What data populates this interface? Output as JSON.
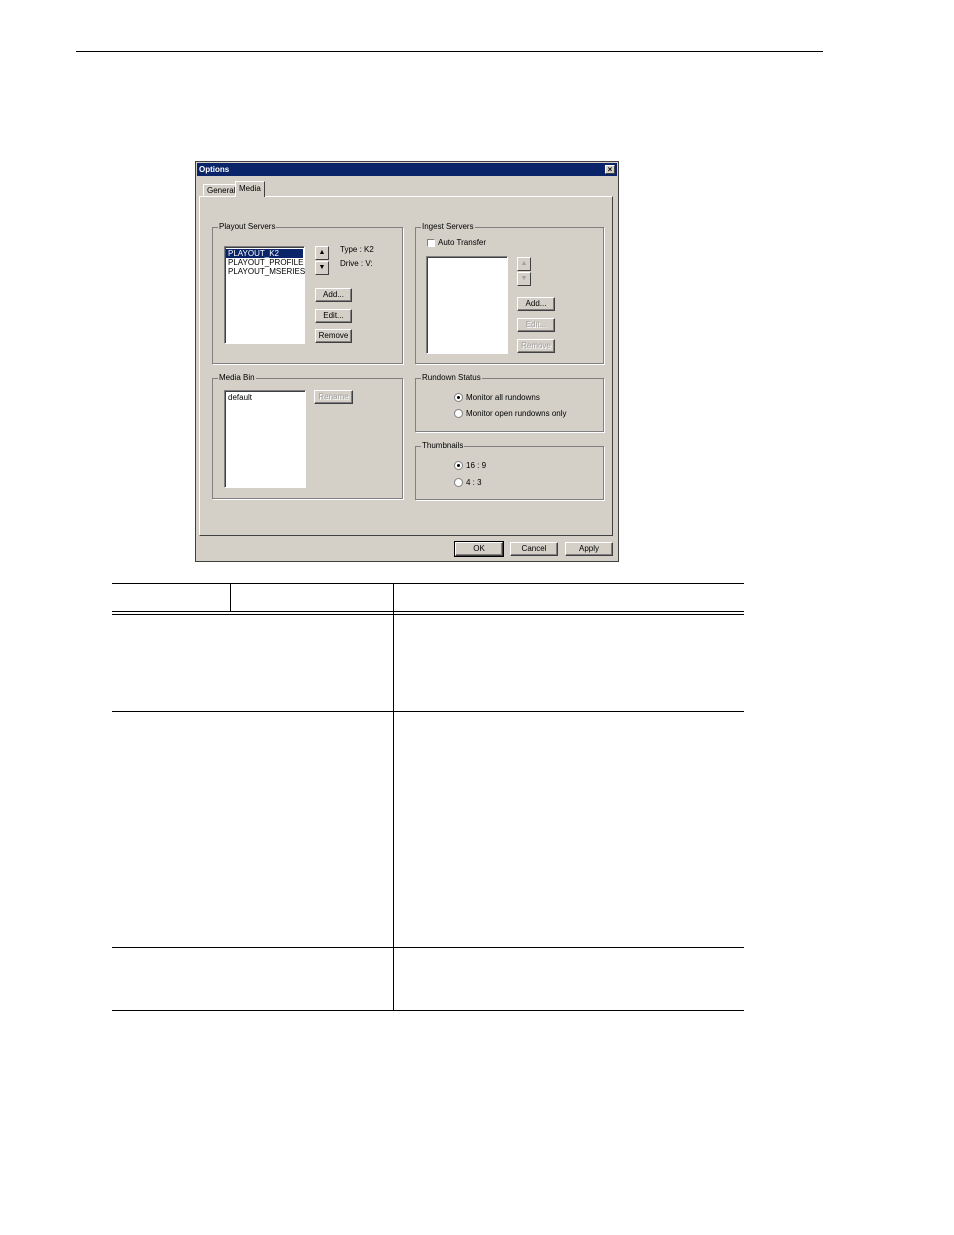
{
  "dialog": {
    "title": "Options",
    "close_glyph": "×",
    "tabs": [
      {
        "label": "General"
      },
      {
        "label": "Media"
      }
    ],
    "playout_servers": {
      "legend": "Playout Servers",
      "items": [
        "PLAYOUT_K2",
        "PLAYOUT_PROFILE",
        "PLAYOUT_MSERIES"
      ],
      "selected_index": 0,
      "type_text": "Type :  K2",
      "drive_text": "Drive :  V:",
      "add_label": "Add...",
      "edit_label": "Edit...",
      "remove_label": "Remove"
    },
    "ingest_servers": {
      "legend": "Ingest Servers",
      "auto_transfer_label": "Auto Transfer",
      "auto_transfer_checked": false,
      "add_label": "Add...",
      "edit_label": "Edit...",
      "remove_label": "Remove"
    },
    "media_bin": {
      "legend": "Media Bin",
      "items": [
        "default"
      ],
      "rename_label": "Rename"
    },
    "rundown_status": {
      "legend": "Rundown Status",
      "options": [
        "Monitor all rundowns",
        "Monitor open rundowns only"
      ],
      "selected_index": 0
    },
    "thumbnails": {
      "legend": "Thumbnails",
      "options": [
        "16 : 9",
        "4 : 3"
      ],
      "selected_index": 0
    },
    "footer": {
      "ok_label": "OK",
      "cancel_label": "Cancel",
      "apply_label": "Apply"
    },
    "icons": {
      "up_arrow": "▲",
      "down_arrow": "▼"
    }
  }
}
